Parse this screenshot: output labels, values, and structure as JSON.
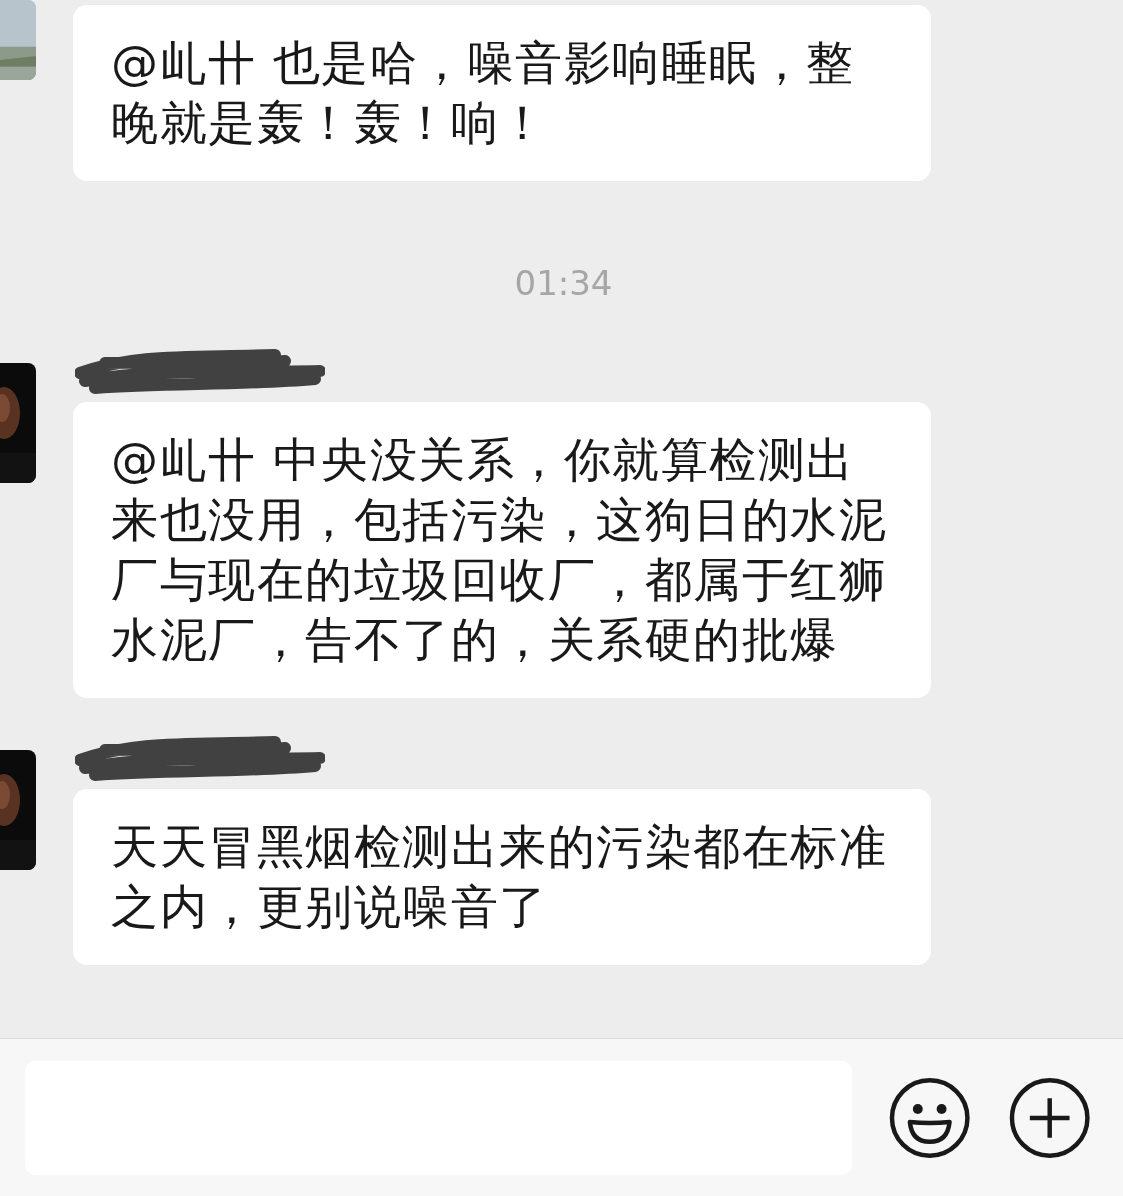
{
  "chat": [
    {
      "kind": "message",
      "name_redacted": false,
      "text": "@乢卄 也是哈，噪音影响睡眠，整晚就是轰！轰！响！"
    },
    {
      "kind": "time",
      "text": "01:34"
    },
    {
      "kind": "message",
      "name_redacted": true,
      "text": "@乢卄 中央没关系，你就算检测出来也没用，包括污染，这狗日的水泥厂与现在的垃圾回收厂，都属于红狮水泥厂，告不了的，关系硬的批爆"
    },
    {
      "kind": "message",
      "name_redacted": true,
      "text": "天天冒黑烟检测出来的污染都在标准之内，更别说噪音了"
    }
  ]
}
